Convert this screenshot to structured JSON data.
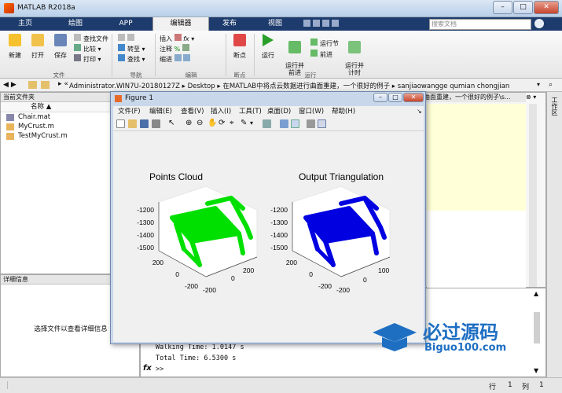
{
  "window": {
    "title": "MATLAB R2018a",
    "min": "–",
    "max": "□",
    "close": "✕"
  },
  "tabs": [
    "主页",
    "绘图",
    "APP",
    "编辑器",
    "发布",
    "视图"
  ],
  "search_placeholder": "搜索文档",
  "ribbon": {
    "new": "新建",
    "open": "打开",
    "save": "保存",
    "find_files": "查找文件",
    "compare": "比较",
    "print": "打印",
    "insert": "插入",
    "comment": "注释",
    "indent": "缩进",
    "goto": "转至",
    "find": "查找",
    "breakpoint": "断点",
    "run": "运行",
    "run_advance": "运行并\n前进",
    "run_section": "运行节",
    "advance": "前进",
    "run_time": "运行并\n计时",
    "sections": [
      "文件",
      "导航",
      "编辑",
      "断点",
      "运行"
    ]
  },
  "address": {
    "path": [
      "Administrator.WIN7U-20180127Z",
      "Desktop",
      "在MATLAB中将点云数据进行曲面重建，一个很好的例子",
      "sanjiaowangge qumian chongjian"
    ]
  },
  "current_folder": {
    "title": "当前文件夹",
    "column": "名称",
    "files": [
      {
        "name": "Chair.mat",
        "icon": "mat-file-icon"
      },
      {
        "name": "MyCrust.m",
        "icon": "m-file-icon"
      },
      {
        "name": "TestMyCrust.m",
        "icon": "m-file-icon"
      }
    ]
  },
  "details": {
    "title": "详细信息",
    "hint": "选择文件以查看详细信息"
  },
  "editor_tab_text": "曲面重建，一个很好的例子\\s...",
  "workspace_label": "工作区",
  "command": {
    "lines": [
      "Walking Time: 1.0147 s",
      "Total Time: 6.5300 s"
    ],
    "prompt": ">>",
    "fx": "fx"
  },
  "figure": {
    "title": "Figure 1",
    "menu": [
      "文件(F)",
      "编辑(E)",
      "查看(V)",
      "插入(I)",
      "工具(T)",
      "桌面(D)",
      "窗口(W)",
      "帮助(H)"
    ],
    "plots": [
      {
        "title": "Points Cloud",
        "color": "#00e000"
      },
      {
        "title": "Output Triangulation",
        "color": "#0000e0"
      }
    ],
    "z_ticks": [
      "-1200",
      "-1300",
      "-1400",
      "-1500"
    ],
    "xy_ticks_left": [
      "200",
      "0",
      "-200"
    ],
    "xy_ticks_right": [
      "-200",
      "0",
      "200"
    ],
    "extra_tick": "100"
  },
  "status": {
    "row_label": "行",
    "row": "1",
    "col_label": "列",
    "col": "1"
  },
  "watermark": {
    "text": "必过源码",
    "sub": "Biguo100.com"
  }
}
